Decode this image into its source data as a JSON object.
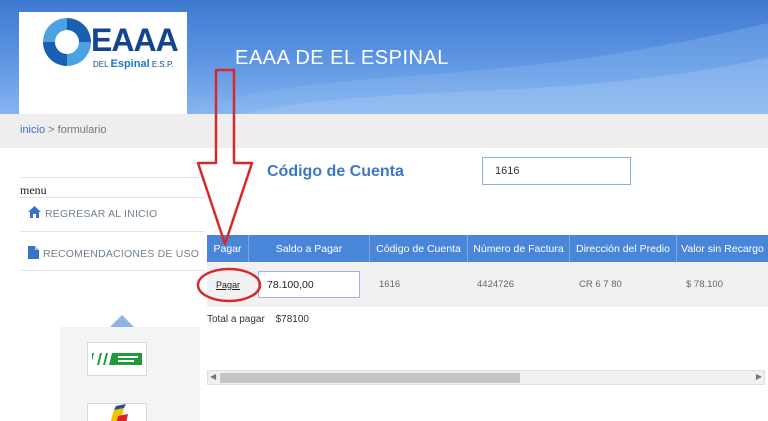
{
  "header": {
    "logo_text": "EAAA",
    "logo_sub_prefix": "DEL",
    "logo_sub_name": "Espinal",
    "logo_sub_suffix": "E.S.P.",
    "site_title": "EAAA DE EL ESPINAL"
  },
  "breadcrumb": {
    "home": "inicio",
    "separator": ">",
    "current": "formulario"
  },
  "sidebar": {
    "menu_title": "menu",
    "items": [
      {
        "label": "REGRESAR AL INICIO",
        "icon": "home-icon"
      },
      {
        "label": "RECOMENDACIONES DE USO",
        "icon": "document-icon"
      }
    ]
  },
  "form": {
    "code_label": "Código de Cuenta",
    "code_value": "1616"
  },
  "table": {
    "headers": [
      "Pagar",
      "Saldo a Pagar",
      "Código de Cuenta",
      "Número de Factura",
      "Dirección del Predio",
      "Valor sin Recargo"
    ],
    "row": {
      "pay_link": "Pagar",
      "saldo": "78.100,00",
      "codigo": "1616",
      "factura": "4424726",
      "direccion": "CR 6 7 80",
      "valor": "$ 78.100"
    }
  },
  "total": {
    "label": "Total a pagar",
    "value": "$78100"
  },
  "colors": {
    "header_blue": "#4a86d8",
    "accent_blue": "#3c77c9",
    "annotation_red": "#d62a2a"
  }
}
